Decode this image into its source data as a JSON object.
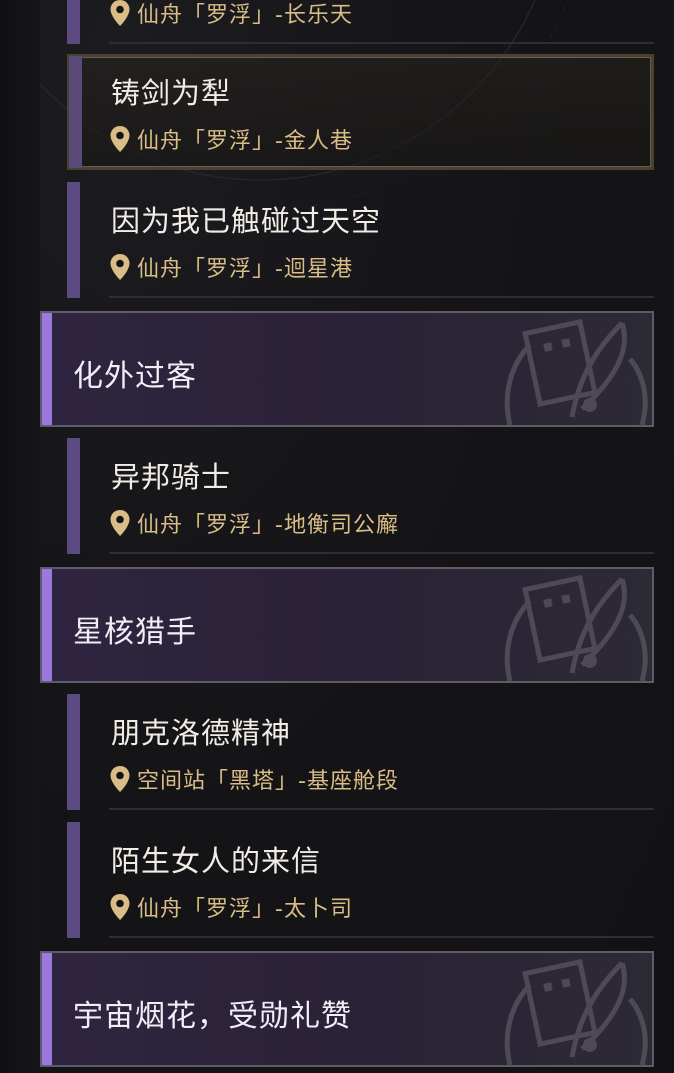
{
  "quests": [
    {
      "title": "",
      "location": "仙舟「罗浮」-长乐天"
    },
    {
      "title": "铸剑为犁",
      "location": "仙舟「罗浮」-金人巷"
    },
    {
      "title": "因为我已触碰过天空",
      "location": "仙舟「罗浮」-迴星港"
    },
    {
      "title": "异邦骑士",
      "location": "仙舟「罗浮」-地衡司公廨"
    },
    {
      "title": "朋克洛德精神",
      "location": "空间站「黑塔」-基座舱段"
    },
    {
      "title": "陌生女人的来信",
      "location": "仙舟「罗浮」-太卜司"
    }
  ],
  "categories": [
    {
      "title": "化外过客"
    },
    {
      "title": "星核猎手"
    },
    {
      "title": "宇宙烟花，受勋礼赞"
    }
  ],
  "colors": {
    "background": "#141416",
    "quest_bar": "#5d4a80",
    "category_accent": "#9a78e0",
    "location_text": "#d9bc86",
    "selected_border": "#6b5c43"
  },
  "icons": {
    "location": "map-pin-icon",
    "category": "scroll-and-quill-emblem-icon"
  }
}
